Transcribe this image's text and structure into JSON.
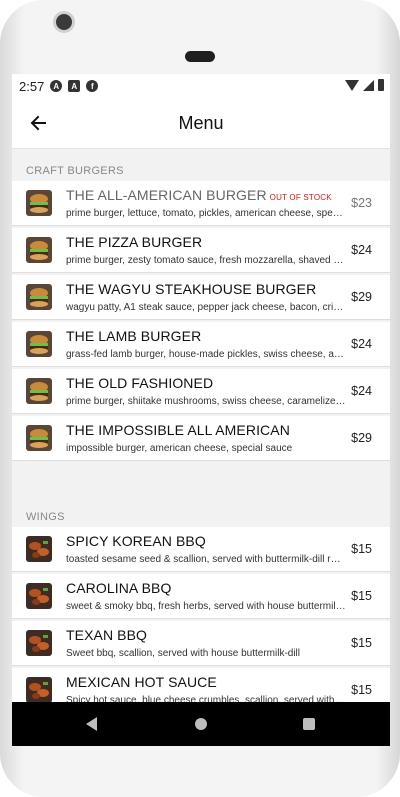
{
  "status_bar": {
    "time": "2:57",
    "icons": [
      "a-icon",
      "sim-icon",
      "f-icon"
    ],
    "right_icons": [
      "wifi-icon",
      "signal-icon",
      "battery-icon"
    ]
  },
  "app_bar": {
    "title": "Menu",
    "back_icon": "arrow-left-icon"
  },
  "sections": [
    {
      "name": "CRAFT BURGERS",
      "items": [
        {
          "title": "THE ALL-AMERICAN BURGER",
          "badge": "OUT OF STOCK",
          "desc": "prime burger, lettuce, tomato, pickles, american cheese, special sauce",
          "price": "$23",
          "image": "burger-image"
        },
        {
          "title": "THE PIZZA BURGER",
          "desc": "prime burger, zesty tomato sauce, fresh mozzarella, shaved parmesan",
          "price": "$24",
          "image": "burger-image"
        },
        {
          "title": "THE WAGYU STEAKHOUSE BURGER",
          "desc": "wagyu patty, A1 steak sauce, pepper jack cheese, bacon, crispy onions",
          "price": "$29",
          "image": "burger-image"
        },
        {
          "title": "THE LAMB BURGER",
          "desc": "grass-fed lamb burger, house-made pickles, swiss cheese, arugula",
          "price": "$24",
          "image": "burger-image"
        },
        {
          "title": "THE OLD FASHIONED",
          "desc": "prime burger, shiitake mushrooms, swiss cheese, caramelized onions",
          "price": "$24",
          "image": "burger-image"
        },
        {
          "title": "THE IMPOSSIBLE ALL AMERICAN",
          "desc": "impossible burger, american cheese, special sauce",
          "price": "$29",
          "image": "burger-image"
        }
      ]
    },
    {
      "name": "WINGS",
      "items": [
        {
          "title": "SPICY KOREAN BBQ",
          "desc": "toasted sesame seed & scallion, served with buttermilk-dill ranch",
          "price": "$15",
          "image": "wings-image"
        },
        {
          "title": "CAROLINA BBQ",
          "desc": "sweet & smoky bbq, fresh herbs, served with house buttermilk-dill",
          "price": "$15",
          "image": "wings-image"
        },
        {
          "title": "TEXAN BBQ",
          "desc": "Sweet bbq, scallion, served with house buttermilk-dill",
          "price": "$15",
          "image": "wings-image"
        },
        {
          "title": "MEXICAN HOT SAUCE",
          "desc": "Spicy hot sauce, blue cheese crumbles, scallion, served with ranch",
          "price": "$15",
          "image": "wings-image"
        }
      ]
    }
  ],
  "nav_bar": {
    "icons": [
      "back-triangle-icon",
      "home-circle-icon",
      "recents-square-icon"
    ]
  },
  "colors": {
    "out_of_stock": "#cc1a1a",
    "nav_bar": "#000000",
    "section_bg": "#f2f2f2"
  }
}
